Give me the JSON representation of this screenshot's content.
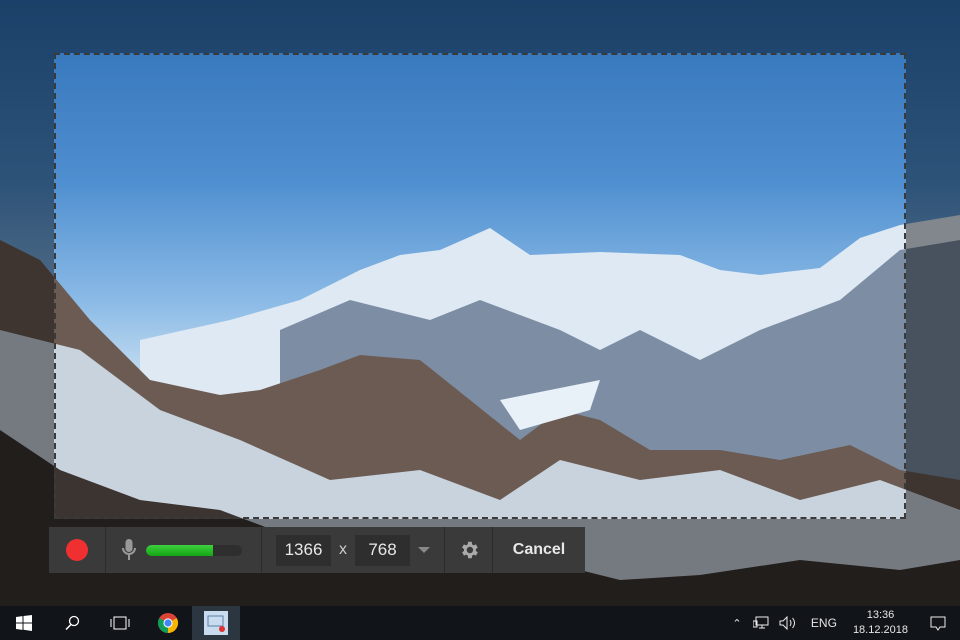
{
  "toolbar": {
    "record_color": "#f03030",
    "mic_level_percent": 70,
    "width": "1366",
    "separator": "x",
    "height": "768",
    "cancel_label": "Cancel"
  },
  "taskbar": {
    "items": [
      "start-icon",
      "search-icon",
      "task-view-icon",
      "chrome-icon",
      "screen-recorder-icon"
    ],
    "tray": {
      "language": "ENG",
      "time": "13:36",
      "date": "18.12.2018"
    }
  }
}
